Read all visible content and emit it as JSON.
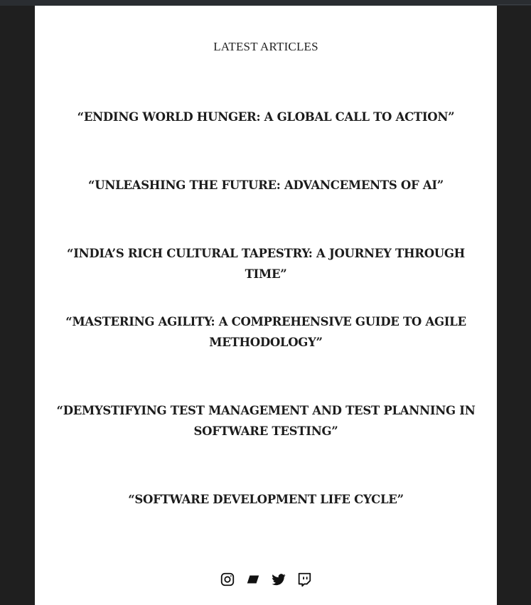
{
  "section": {
    "title": "LATEST ARTICLES"
  },
  "articles": [
    {
      "title": "“ENDING WORLD HUNGER: A GLOBAL CALL TO ACTION”"
    },
    {
      "title": "“UNLEASHING THE FUTURE: ADVANCEMENTS OF AI”"
    },
    {
      "title": "“INDIA’S RICH CULTURAL TAPESTRY: A JOURNEY THROUGH TIME”"
    },
    {
      "title": "“MASTERING AGILITY: A COMPREHENSIVE GUIDE TO AGILE METHODOLOGY”"
    },
    {
      "title": "“DEMYSTIFYING TEST MANAGEMENT AND TEST PLANNING IN SOFTWARE TESTING”"
    },
    {
      "title": "“SOFTWARE DEVELOPMENT LIFE CYCLE”"
    }
  ],
  "social": [
    {
      "icon": "instagram-icon"
    },
    {
      "icon": "bandcamp-icon"
    },
    {
      "icon": "twitter-icon"
    },
    {
      "icon": "twitch-icon"
    }
  ],
  "colors": {
    "page_background": "#1f1f1f",
    "content_background": "#ffffff",
    "text": "#1c1c1c"
  }
}
